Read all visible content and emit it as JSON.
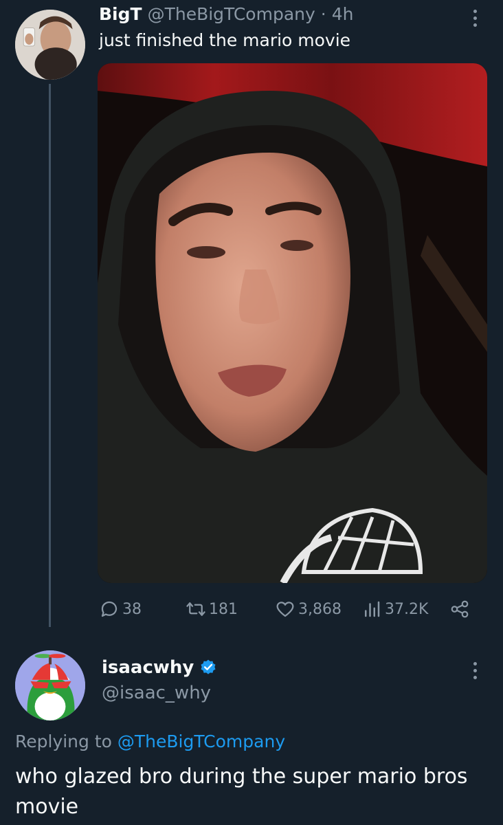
{
  "tweet": {
    "author_name": "BigT",
    "author_handle": "@TheBigTCompany",
    "separator": "·",
    "time": "4h",
    "text": "just finished the mario movie",
    "stats": {
      "replies": "38",
      "retweets": "181",
      "likes": "3,868",
      "views": "37.2K"
    }
  },
  "reply": {
    "author_name": "isaacwhy",
    "author_handle": "@isaac_why",
    "replying_prefix": "Replying to",
    "replying_to": "@TheBigTCompany",
    "text": "who glazed bro during the super mario bros movie"
  },
  "icons": {
    "reply": "speech-bubble-icon",
    "retweet": "retweet-arrows-icon",
    "like": "heart-icon",
    "views": "bar-chart-icon",
    "share": "share-nodes-icon",
    "more": "more-dots-vertical-icon",
    "verified": "verified-badge-icon"
  },
  "colors": {
    "background": "#15202b",
    "text_primary": "#f7f9f9",
    "text_secondary": "#8b98a5",
    "accent": "#1d9bf0",
    "thread_line": "#425364"
  }
}
